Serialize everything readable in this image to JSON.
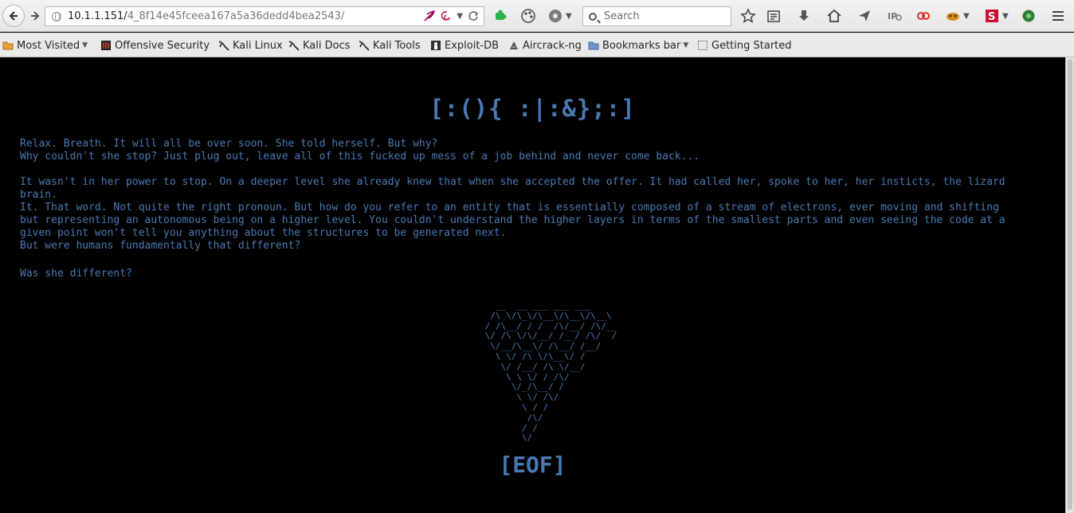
{
  "toolbar": {
    "url_host": "10.1.1.151/",
    "url_path": "4_8f14e45fceea167a5a36dedd4bea2543/",
    "search_placeholder": "Search"
  },
  "bookmarks": [
    {
      "label": "Most Visited",
      "has_arrow": true
    },
    {
      "label": "Offensive Security"
    },
    {
      "label": "Kali Linux"
    },
    {
      "label": "Kali Docs"
    },
    {
      "label": "Kali Tools"
    },
    {
      "label": "Exploit-DB"
    },
    {
      "label": "Aircrack-ng"
    },
    {
      "label": "Bookmarks bar",
      "has_arrow": true
    },
    {
      "label": "Getting Started"
    }
  ],
  "page": {
    "title": "[:(){ :|:&};:]",
    "p1": "Relax. Breath. It will all be over soon. She told herself. But why?\nWhy couldn't she stop? Just plug out, leave all of this fucked up mess of a job behind and never come back...\n\nIt wasn't in her power to stop. On a deeper level she already knew that when she accepted the offer. It had called her, spoke to her, her insticts, the lizard\nbrain.\nIt. That word. Not quite the right pronoun. But how do you refer to an entity that is essentially composed of a stream of electrons, ever moving and shifting\nbut representing an autonomous being on a higher level. You couldn't understand the higher layers in terms of the smallest parts and even seeing the code at a\ngiven point won't tell you anything about the structures to be generated next.\nBut were humans fundamentally that different?",
    "p2": "Was she different?",
    "ascii": "   __  __ ___ ___ ___\n  /\\ \\/\\_\\/\\__\\/\\__\\/\\__\\\n / /\\__/ / /  /\\/__/ /\\/__\n \\/ /\\ \\/\\/__/ /__/ /\\/  /\n  \\/__/\\__\\/ /\\__/ /__/\n   \\ \\/ /\\ \\/\\__\\/ /\n    \\/ /__/ /\\ \\/__/\n     \\ \\ \\/ / /\\/\n      \\/_/\\__/ /\n       \\ \\/ /\\/\n        \\ / /\n         /\\/\n        / /\n        \\/",
    "eof": "[EOF]"
  },
  "colors": {
    "text_blue": "#4a79b3",
    "background": "#000000"
  }
}
